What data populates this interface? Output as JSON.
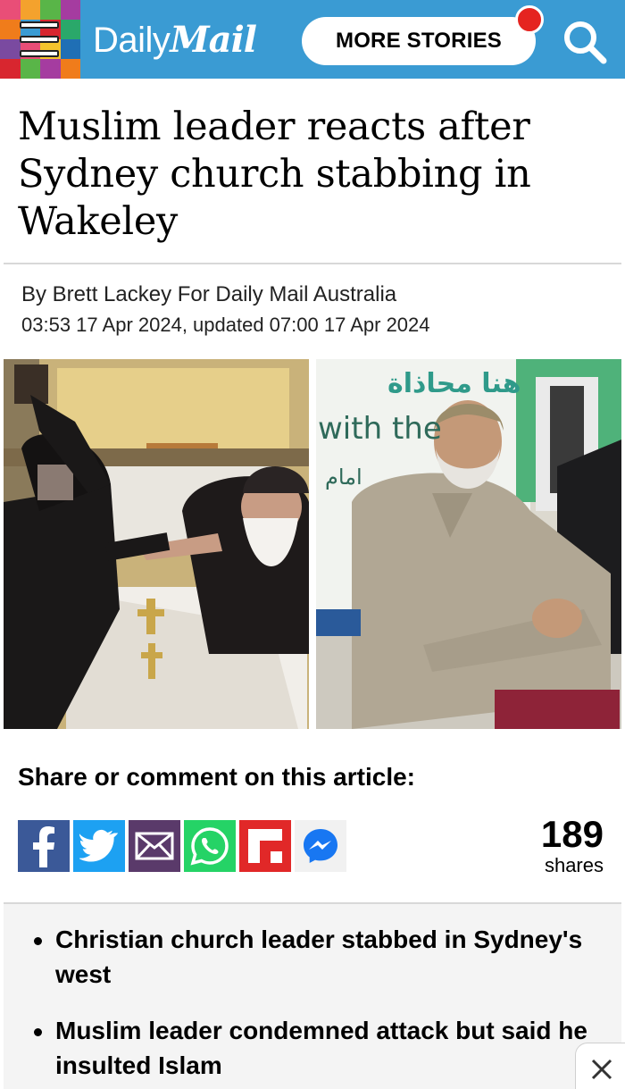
{
  "header": {
    "logo_part1": "Daily",
    "logo_part2": "Mail",
    "more_stories_label": "MORE STORIES",
    "bg_color": "#3a9bd3",
    "notification_color": "#e52420"
  },
  "article": {
    "headline": "Muslim leader reacts after Sydney church stabbing in Wakeley",
    "byline": "By Brett Lackey For Daily Mail Australia",
    "dates": "03:53 17 Apr 2024, updated 07:00 17 Apr 2024",
    "image_left_text": "",
    "image_right_text_arabic": "هنا محاذاة",
    "image_right_text_english": "with the",
    "image_right_text_arabic_2": "امام"
  },
  "share": {
    "title": "Share or comment on this article:",
    "buttons": [
      {
        "name": "facebook",
        "icon": "facebook-icon",
        "color": "#3b5998"
      },
      {
        "name": "twitter",
        "icon": "twitter-icon",
        "color": "#1da1f2"
      },
      {
        "name": "email",
        "icon": "email-icon",
        "color": "#5a3a6a"
      },
      {
        "name": "whatsapp",
        "icon": "whatsapp-icon",
        "color": "#25d366"
      },
      {
        "name": "flipboard",
        "icon": "flipboard-icon",
        "color": "#e12828"
      },
      {
        "name": "messenger",
        "icon": "messenger-icon",
        "color": "#0084ff"
      }
    ],
    "count": "189",
    "count_label": "shares"
  },
  "bullets": [
    "Christian church leader stabbed in Sydney's west",
    "Muslim leader condemned attack but said he insulted Islam"
  ]
}
